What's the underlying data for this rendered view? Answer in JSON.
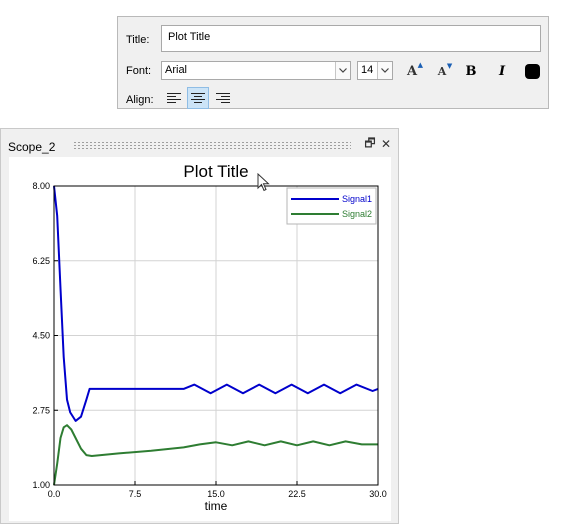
{
  "panel": {
    "title_label": "Title:",
    "title_value": "Plot Title",
    "font_label": "Font:",
    "font_value": "Arial",
    "size_value": "14",
    "align_label": "Align:",
    "bold_glyph": "B",
    "italic_glyph": "I",
    "increase_font_glyph": "A",
    "decrease_font_glyph": "A",
    "text_color": "#000000",
    "selected_alignment": "center"
  },
  "scope": {
    "name": "Scope_2",
    "undock_glyph": "🗗",
    "close_glyph": "✕"
  },
  "chart_data": {
    "type": "line",
    "title": "Plot Title",
    "xlabel": "time",
    "ylabel": "",
    "xlim": [
      0,
      30
    ],
    "ylim": [
      1,
      8
    ],
    "xticks": [
      "0.0",
      "7.5",
      "15.0",
      "22.5",
      "30.0"
    ],
    "yticks": [
      "1.00",
      "2.75",
      "4.50",
      "6.25",
      "8.00"
    ],
    "grid": true,
    "legend_position": "top-right",
    "series": [
      {
        "name": "Signal1",
        "color": "#0000cc",
        "x": [
          0,
          0.3,
          0.6,
          0.9,
          1.2,
          1.5,
          2.0,
          2.5,
          3.0,
          3.3,
          12.0,
          13.0,
          14.5,
          16,
          17.5,
          19,
          20.5,
          22,
          23.5,
          25,
          26.5,
          28,
          29.5,
          30
        ],
        "y": [
          8.0,
          7.3,
          5.6,
          4.0,
          3.0,
          2.7,
          2.5,
          2.6,
          3.0,
          3.25,
          3.25,
          3.35,
          3.15,
          3.35,
          3.15,
          3.35,
          3.15,
          3.35,
          3.15,
          3.35,
          3.15,
          3.35,
          3.2,
          3.25
        ]
      },
      {
        "name": "Signal2",
        "color": "#2e7d32",
        "x": [
          0,
          0.3,
          0.6,
          0.9,
          1.2,
          1.6,
          2.0,
          2.5,
          3.0,
          3.5,
          6,
          9,
          12,
          13.5,
          15,
          16.5,
          18,
          19.5,
          21,
          22.5,
          24,
          25.5,
          27,
          28.5,
          30
        ],
        "y": [
          1.0,
          1.5,
          2.1,
          2.35,
          2.4,
          2.3,
          2.1,
          1.85,
          1.7,
          1.68,
          1.74,
          1.8,
          1.88,
          1.95,
          2.0,
          1.93,
          2.02,
          1.93,
          2.02,
          1.93,
          2.02,
          1.93,
          2.02,
          1.95,
          1.95
        ]
      }
    ]
  }
}
